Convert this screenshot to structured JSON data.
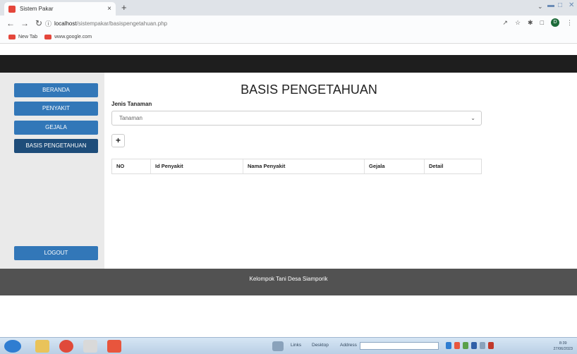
{
  "browser": {
    "tab_title": "Sistem Pakar",
    "tab_close": "×",
    "new_tab": "+",
    "url_host": "localhost",
    "url_path": "/sistempakar/basispengetahuan.php",
    "bookmarks": [
      "New Tab",
      "www.google.com"
    ],
    "profile_initial": "D"
  },
  "sidebar": {
    "items": [
      {
        "label": "BERANDA"
      },
      {
        "label": "PENYAKIT"
      },
      {
        "label": "GEJALA"
      },
      {
        "label": "BASIS PENGETAHUAN"
      }
    ],
    "logout_label": "LOGOUT"
  },
  "main": {
    "title": "BASIS PENGETAHUAN",
    "jenis_label": "Jenis Tanaman",
    "select_value": "Tanaman",
    "add_label": "+",
    "table_headers": [
      "NO",
      "Id Penyakit",
      "Nama Penyakit",
      "Gejala",
      "Detail"
    ]
  },
  "footer": {
    "text": "Kelompok Tani Desa Siamporik"
  },
  "taskbar": {
    "links": "Links",
    "desktop": "Desktop",
    "address": "Address",
    "time": "8:39",
    "date": "27/06/2023"
  },
  "colors": {
    "accent": "#3277b8",
    "active": "#1e4d7a",
    "topnav": "#1e1e1e",
    "footer": "#525252"
  }
}
